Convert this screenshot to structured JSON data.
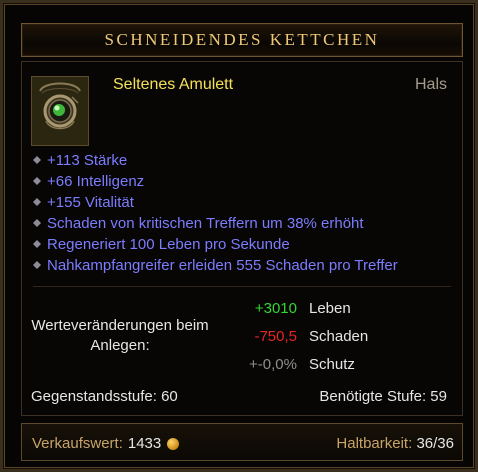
{
  "item": {
    "name": "SCHNEIDENDES KETTCHEN",
    "type": "Seltenes Amulett",
    "slot": "Hals",
    "icon": "amulet-icon"
  },
  "affixes": [
    "+113 Stärke",
    "+66 Intelligenz",
    "+155 Vitalität",
    "Schaden von kritischen Treffern um 38% erhöht",
    "Regeneriert 100 Leben pro Sekunde",
    "Nahkampfangreifer erleiden 555 Schaden pro Treffer"
  ],
  "changes": {
    "label_line1": "Werteveränderungen beim",
    "label_line2": "Anlegen:",
    "stats": [
      {
        "value": "+3010",
        "name": "Leben",
        "color": "#34d534"
      },
      {
        "value": "-750,5",
        "name": "Schaden",
        "color": "#e22525"
      },
      {
        "value": "+-0,0%",
        "name": "Schutz",
        "color": "#8e8e8e"
      }
    ]
  },
  "levels": {
    "item_level": "Gegenstandsstufe: 60",
    "required_level": "Benötigte Stufe: 59"
  },
  "footer": {
    "sell_label": "Verkaufswert:",
    "sell_value": "1433",
    "durability_label": "Haltbarkeit:",
    "durability_value": "36/36"
  },
  "colors": {
    "title": "#f0c978",
    "rare": "#f5e05a",
    "affix": "#7c7cff"
  }
}
